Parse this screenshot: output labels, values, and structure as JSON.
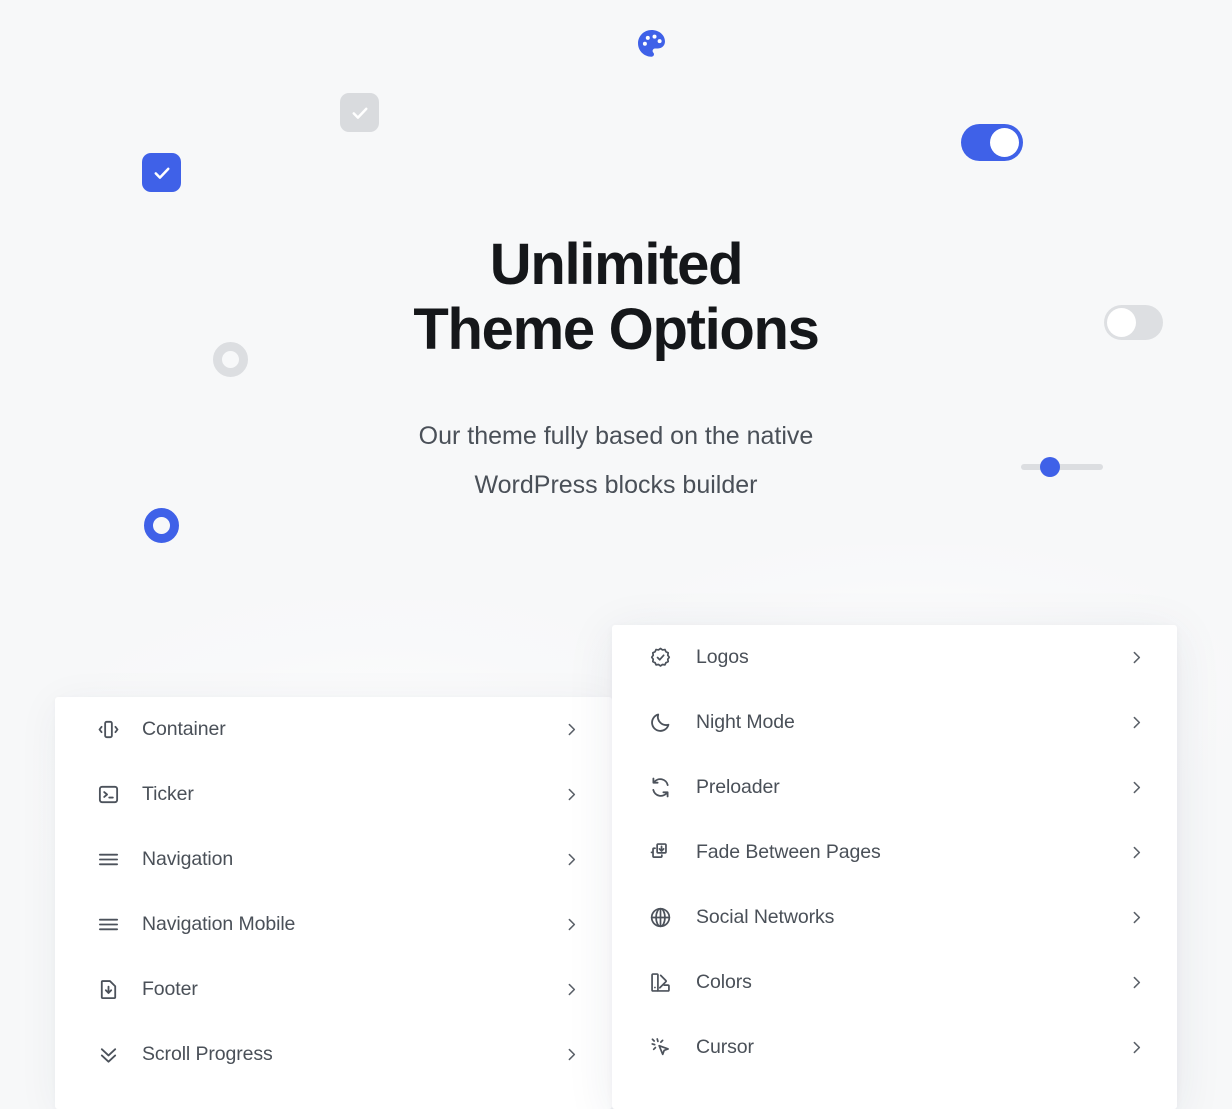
{
  "hero": {
    "title": "Unlimited\nTheme Options",
    "subtitle": "Our theme fully based on the native\nWordPress blocks builder"
  },
  "colors": {
    "accent": "#3f61e8",
    "page_background": "#f7f8f9",
    "panel_background": "#ffffff",
    "text_primary": "#15171a",
    "text_secondary": "#4a5058",
    "control_inactive": "#dcdee1"
  },
  "decorations": [
    {
      "name": "palette-icon",
      "type": "icon",
      "icon": "palette-icon",
      "state": "static",
      "color": "#3f61e8"
    },
    {
      "name": "checkbox-inactive",
      "type": "checkbox",
      "icon": "check-icon",
      "state": "unchecked-disabled"
    },
    {
      "name": "checkbox-checked",
      "type": "checkbox",
      "icon": "check-icon",
      "state": "checked"
    },
    {
      "name": "toggle-on",
      "type": "toggle",
      "state": "on"
    },
    {
      "name": "toggle-off",
      "type": "toggle",
      "state": "off"
    },
    {
      "name": "radio-unselected",
      "type": "radio",
      "state": "off"
    },
    {
      "name": "radio-selected",
      "type": "radio",
      "state": "on"
    },
    {
      "name": "range-slider",
      "type": "slider",
      "value": 30,
      "min": 0,
      "max": 100
    }
  ],
  "panel_left": {
    "items": [
      {
        "label": "Container",
        "icon": "container-icon",
        "arrow": "chevron-right-icon"
      },
      {
        "label": "Ticker",
        "icon": "terminal-icon",
        "arrow": "chevron-right-icon"
      },
      {
        "label": "Navigation",
        "icon": "menu-lines-icon",
        "arrow": "chevron-right-icon"
      },
      {
        "label": "Navigation Mobile",
        "icon": "menu-lines-icon",
        "arrow": "chevron-right-icon"
      },
      {
        "label": "Footer",
        "icon": "file-down-icon",
        "arrow": "chevron-right-icon"
      },
      {
        "label": "Scroll Progress",
        "icon": "chevrons-down-icon",
        "arrow": "chevron-right-icon"
      }
    ]
  },
  "panel_right": {
    "items": [
      {
        "label": "Logos",
        "icon": "badge-check-icon",
        "arrow": "chevron-right-icon"
      },
      {
        "label": "Night Mode",
        "icon": "moon-icon",
        "arrow": "chevron-right-icon"
      },
      {
        "label": "Preloader",
        "icon": "refresh-icon",
        "arrow": "chevron-right-icon"
      },
      {
        "label": "Fade Between Pages",
        "icon": "layers-import-icon",
        "arrow": "chevron-right-icon"
      },
      {
        "label": "Social Networks",
        "icon": "globe-icon",
        "arrow": "chevron-right-icon"
      },
      {
        "label": "Colors",
        "icon": "swatch-icon",
        "arrow": "chevron-right-icon"
      },
      {
        "label": "Cursor",
        "icon": "cursor-sparkle-icon",
        "arrow": "chevron-right-icon"
      }
    ]
  }
}
